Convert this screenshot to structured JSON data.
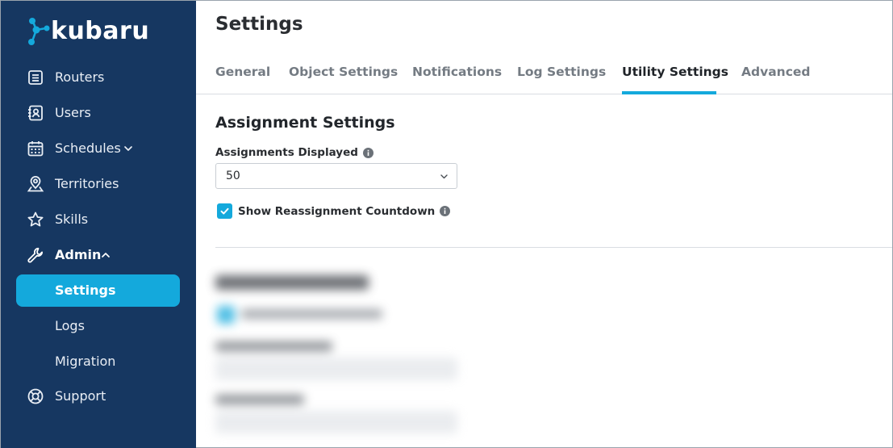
{
  "brand": {
    "name": "kubaru",
    "accent": "#14a9dc",
    "sidebar_bg": "#163761"
  },
  "sidebar": {
    "items": [
      {
        "label": "Routers",
        "icon": "list-icon"
      },
      {
        "label": "Users",
        "icon": "contacts-icon"
      },
      {
        "label": "Schedules",
        "icon": "calendar-icon",
        "expanded": false
      },
      {
        "label": "Territories",
        "icon": "location-pin-icon"
      },
      {
        "label": "Skills",
        "icon": "star-icon"
      },
      {
        "label": "Admin",
        "icon": "wrench-icon",
        "expanded": true
      },
      {
        "label": "Support",
        "icon": "lifebuoy-icon"
      }
    ],
    "admin_subitems": [
      {
        "label": "Settings",
        "active": true
      },
      {
        "label": "Logs",
        "active": false
      },
      {
        "label": "Migration",
        "active": false
      }
    ]
  },
  "page": {
    "title": "Settings"
  },
  "tabs": [
    {
      "label": "General",
      "active": false
    },
    {
      "label": "Object Settings",
      "active": false
    },
    {
      "label": "Notifications",
      "active": false
    },
    {
      "label": "Log Settings",
      "active": false
    },
    {
      "label": "Utility Settings",
      "active": true
    },
    {
      "label": "Advanced",
      "active": false
    }
  ],
  "assignment": {
    "section_title": "Assignment Settings",
    "assignments_label": "Assignments Displayed",
    "assignments_value": "50",
    "countdown_label": "Show Reassignment Countdown",
    "countdown_checked": true
  }
}
